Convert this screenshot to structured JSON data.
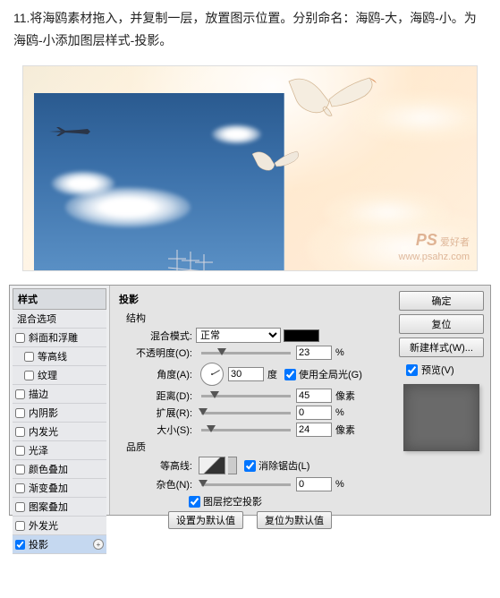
{
  "instruction": "11.将海鸥素材拖入，并复制一层，放置图示位置。分别命名：海鸥-大，海鸥-小。为海鸥-小添加图层样式-投影。",
  "watermark": {
    "logo": "PS",
    "text": "爱好者",
    "url": "www.psahz.com"
  },
  "styles": {
    "header": "样式",
    "blend": "混合选项",
    "rows": [
      {
        "label": "斜面和浮雕",
        "checked": false
      },
      {
        "label": "等高线",
        "checked": false,
        "indent": true
      },
      {
        "label": "纹理",
        "checked": false,
        "indent": true
      },
      {
        "label": "描边",
        "checked": false
      },
      {
        "label": "内阴影",
        "checked": false
      },
      {
        "label": "内发光",
        "checked": false
      },
      {
        "label": "光泽",
        "checked": false
      },
      {
        "label": "颜色叠加",
        "checked": false
      },
      {
        "label": "渐变叠加",
        "checked": false
      },
      {
        "label": "图案叠加",
        "checked": false
      },
      {
        "label": "外发光",
        "checked": false
      },
      {
        "label": "投影",
        "checked": true,
        "selected": true
      }
    ]
  },
  "panel": {
    "title": "投影",
    "struct": "结构",
    "blend_mode_label": "混合模式:",
    "blend_mode_value": "正常",
    "opacity_label": "不透明度(O):",
    "opacity_value": "23",
    "angle_label": "角度(A):",
    "angle_value": "30",
    "angle_unit": "度",
    "global_light": "使用全局光(G)",
    "distance_label": "距离(D):",
    "distance_value": "45",
    "spread_label": "扩展(R):",
    "spread_value": "0",
    "size_label": "大小(S):",
    "size_value": "24",
    "px": "像素",
    "pct": "%",
    "quality": "品质",
    "contour_label": "等高线:",
    "antialias": "消除锯齿(L)",
    "noise_label": "杂色(N):",
    "noise_value": "0",
    "knockout": "图层挖空投影",
    "default_btn": "设置为默认值",
    "reset_btn": "复位为默认值"
  },
  "buttons": {
    "ok": "确定",
    "cancel": "复位",
    "new_style": "新建样式(W)...",
    "preview": "预览(V)"
  }
}
